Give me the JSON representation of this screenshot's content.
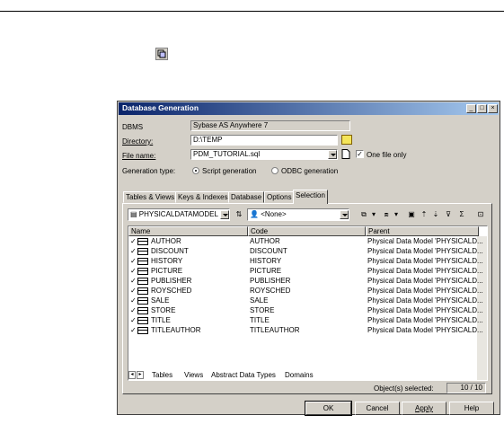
{
  "dialog": {
    "title": "Database Generation",
    "dbms_label": "DBMS",
    "dbms_value": "Sybase AS Anywhere 7",
    "directory_label": "Directory:",
    "directory_value": "D:\\TEMP",
    "filename_label": "File name:",
    "filename_value": "PDM_TUTORIAL.sql",
    "one_file_label": "One file only",
    "gentype_label": "Generation type:",
    "script_gen_label": "Script generation",
    "odbc_gen_label": "ODBC generation"
  },
  "tabs": [
    "Tables & Views",
    "Keys & Indexes",
    "Database",
    "Options",
    "Selection"
  ],
  "selection": {
    "model_combo": "PHYSICALDATAMODEL",
    "owner_combo": "<None>",
    "columns": [
      "Name",
      "Code",
      "Parent"
    ],
    "rows": [
      {
        "name": "AUTHOR",
        "code": "AUTHOR",
        "parent": "Physical Data Model 'PHYSICALD..."
      },
      {
        "name": "DISCOUNT",
        "code": "DISCOUNT",
        "parent": "Physical Data Model 'PHYSICALD..."
      },
      {
        "name": "HISTORY",
        "code": "HISTORY",
        "parent": "Physical Data Model 'PHYSICALD..."
      },
      {
        "name": "PICTURE",
        "code": "PICTURE",
        "parent": "Physical Data Model 'PHYSICALD..."
      },
      {
        "name": "PUBLISHER",
        "code": "PUBLISHER",
        "parent": "Physical Data Model 'PHYSICALD..."
      },
      {
        "name": "ROYSCHED",
        "code": "ROYSCHED",
        "parent": "Physical Data Model 'PHYSICALD..."
      },
      {
        "name": "SALE",
        "code": "SALE",
        "parent": "Physical Data Model 'PHYSICALD..."
      },
      {
        "name": "STORE",
        "code": "STORE",
        "parent": "Physical Data Model 'PHYSICALD..."
      },
      {
        "name": "TITLE",
        "code": "TITLE",
        "parent": "Physical Data Model 'PHYSICALD..."
      },
      {
        "name": "TITLEAUTHOR",
        "code": "TITLEAUTHOR",
        "parent": "Physical Data Model 'PHYSICALD..."
      }
    ],
    "sheet_tabs": [
      "Tables",
      "Views",
      "Abstract Data Types",
      "Domains"
    ],
    "selected_label": "Object(s) selected:",
    "selected_count": "10 / 10"
  },
  "buttons": {
    "ok": "OK",
    "cancel": "Cancel",
    "apply": "Apply",
    "help": "Help"
  },
  "colors": {
    "titlebar": "#0a246a",
    "dialog_bg": "#d4d0c8"
  }
}
